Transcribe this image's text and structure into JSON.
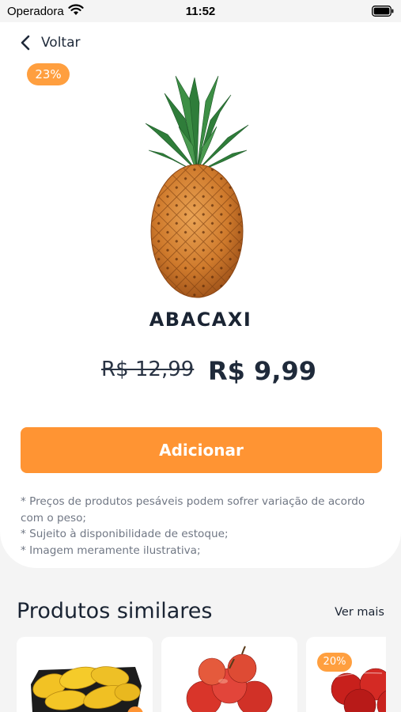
{
  "status_bar": {
    "carrier": "Operadora",
    "time": "11:52"
  },
  "header": {
    "back_label": "Voltar"
  },
  "product": {
    "discount": "23%",
    "name": "ABACAXI",
    "old_price": "R$ 12,99",
    "price": "R$ 9,99",
    "add_label": "Adicionar",
    "disclaimers": [
      "* Preços de produtos pesáveis podem sofrer variação de acordo com o peso;",
      "* Sujeito à disponibilidade de estoque;",
      "* Imagem meramente ilustrativa;"
    ]
  },
  "similar": {
    "title": "Produtos similares",
    "see_more": "Ver mais",
    "items": [
      {
        "image": "mango-tray-image"
      },
      {
        "image": "apples-image"
      },
      {
        "image": "red-apples-bag-image",
        "discount": "20%"
      }
    ]
  },
  "colors": {
    "accent": "#ff9433",
    "badge": "#ff9f3f",
    "text": "#1f2a3a"
  }
}
